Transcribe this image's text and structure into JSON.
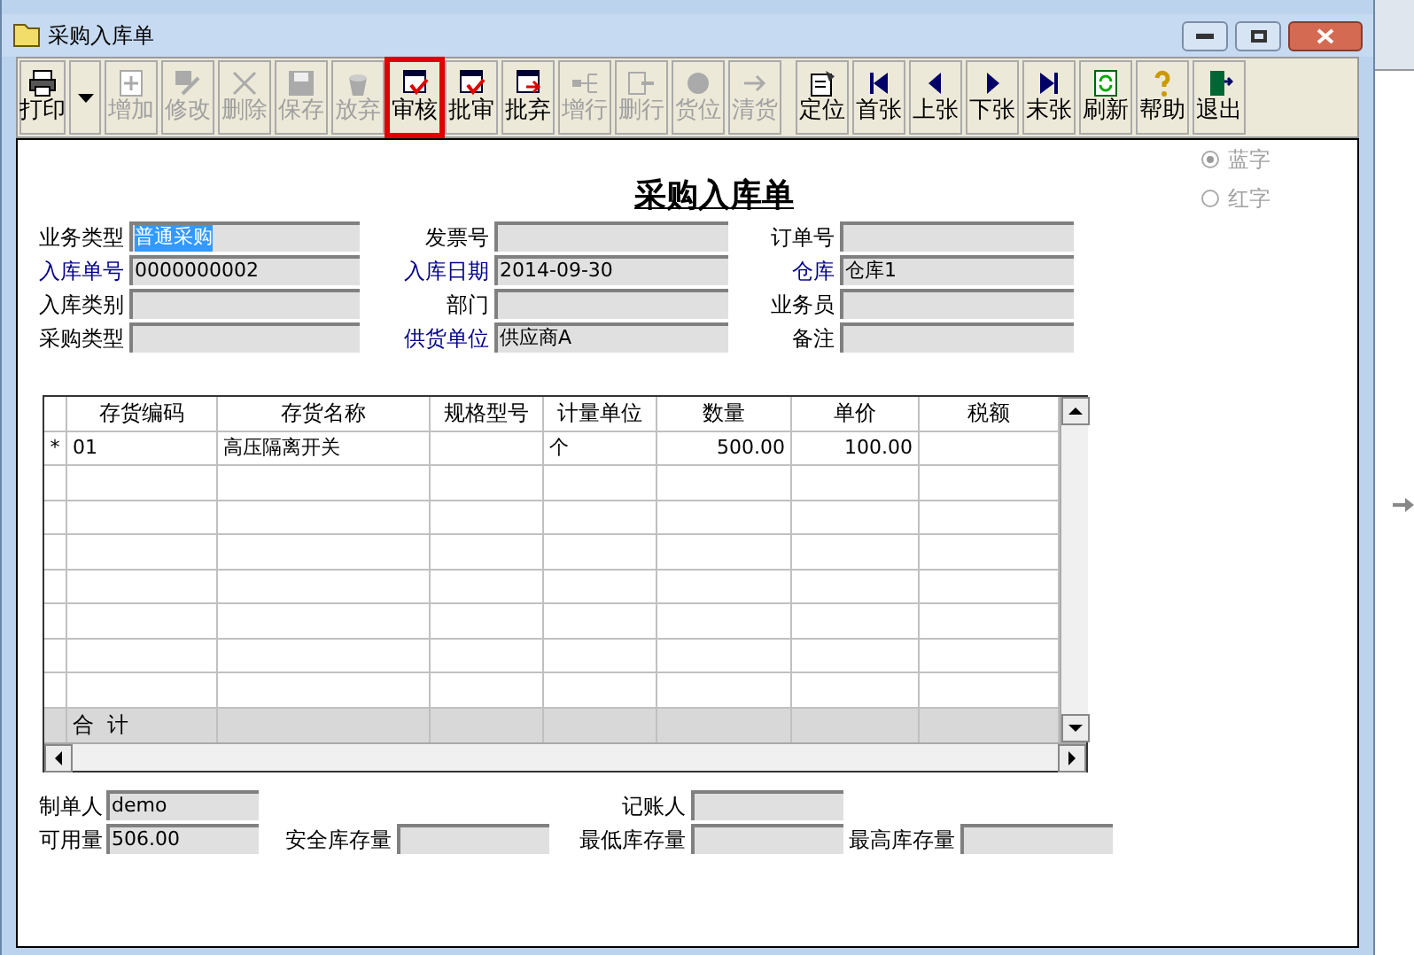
{
  "window": {
    "title": "采购入库单"
  },
  "toolbar": [
    {
      "label": "打印",
      "disabled": false,
      "highlighted": false
    },
    {
      "label": "增加",
      "disabled": true,
      "highlighted": false
    },
    {
      "label": "修改",
      "disabled": true,
      "highlighted": false
    },
    {
      "label": "删除",
      "disabled": true,
      "highlighted": false
    },
    {
      "label": "保存",
      "disabled": true,
      "highlighted": false
    },
    {
      "label": "放弃",
      "disabled": true,
      "highlighted": false
    },
    {
      "label": "审核",
      "disabled": false,
      "highlighted": true
    },
    {
      "label": "批审",
      "disabled": false,
      "highlighted": false
    },
    {
      "label": "批弃",
      "disabled": false,
      "highlighted": false
    },
    {
      "label": "增行",
      "disabled": true,
      "highlighted": false
    },
    {
      "label": "删行",
      "disabled": true,
      "highlighted": false
    },
    {
      "label": "货位",
      "disabled": true,
      "highlighted": false
    },
    {
      "label": "清货",
      "disabled": true,
      "highlighted": false
    },
    {
      "label": "定位",
      "disabled": false,
      "highlighted": false
    },
    {
      "label": "首张",
      "disabled": false,
      "highlighted": false
    },
    {
      "label": "上张",
      "disabled": false,
      "highlighted": false
    },
    {
      "label": "下张",
      "disabled": false,
      "highlighted": false
    },
    {
      "label": "末张",
      "disabled": false,
      "highlighted": false
    },
    {
      "label": "刷新",
      "disabled": false,
      "highlighted": false
    },
    {
      "label": "帮助",
      "disabled": false,
      "highlighted": false
    },
    {
      "label": "退出",
      "disabled": false,
      "highlighted": false
    }
  ],
  "form_title": "采购入库单",
  "color_options": [
    {
      "label": "蓝字",
      "selected": true
    },
    {
      "label": "红字",
      "selected": false
    }
  ],
  "header_fields": [
    {
      "label": "业务类型",
      "required": false,
      "value": "普通采购",
      "highlighted": true
    },
    {
      "label": "发票号",
      "required": false,
      "highlighted": false
    },
    {
      "label": "订单号",
      "required": false,
      "highlighted": false
    },
    {
      "label": "入库单号",
      "required": true,
      "value": "0000000002",
      "highlighted": false
    },
    {
      "label": "入库日期",
      "required": true,
      "value": "2014-09-30",
      "highlighted": false
    },
    {
      "label": "仓库",
      "required": true,
      "value": "仓库1",
      "highlighted": false
    },
    {
      "label": "入库类别",
      "required": false,
      "highlighted": false
    },
    {
      "label": "部门",
      "required": false,
      "highlighted": false
    },
    {
      "label": "业务员",
      "required": false,
      "highlighted": false
    },
    {
      "label": "采购类型",
      "required": false,
      "highlighted": false
    },
    {
      "label": "供货单位",
      "required": true,
      "value": "供应商A",
      "highlighted": false
    },
    {
      "label": "备注",
      "required": false,
      "highlighted": false
    }
  ],
  "table": {
    "columns": [
      "存货编码",
      "存货名称",
      "规格型号",
      "计量单位",
      "数量",
      "单价",
      "税额"
    ],
    "rows": [
      {
        "marker": "*",
        "cells": [
          "01",
          "高压隔离开关",
          "",
          "个",
          "500.00",
          "100.00",
          ""
        ]
      }
    ],
    "total_label": "合  计"
  },
  "footer_fields": [
    {
      "label": "制单人",
      "value": "demo"
    },
    {
      "label": "记账人"
    },
    {
      "label": "可用量",
      "value": "506.00"
    },
    {
      "label": "安全库存量"
    },
    {
      "label": "最低库存量"
    },
    {
      "label": "最高库存量"
    }
  ]
}
